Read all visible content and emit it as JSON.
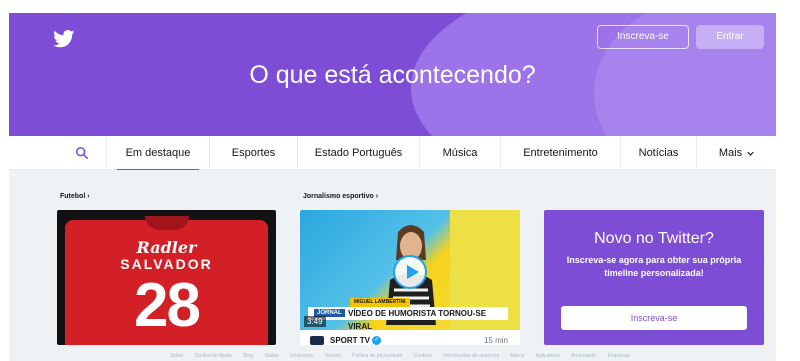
{
  "header": {
    "title": "O que está acontecendo?",
    "signup_label": "Inscreva-se",
    "login_label": "Entrar",
    "logo_icon": "twitter-bird-icon",
    "accent_color": "#7e4dd6"
  },
  "nav": {
    "search_icon": "search-icon",
    "tabs": [
      {
        "label": "Em destaque",
        "active": true
      },
      {
        "label": "Esportes",
        "active": false
      },
      {
        "label": "Estado Português",
        "active": false
      },
      {
        "label": "Música",
        "active": false
      },
      {
        "label": "Entretenimento",
        "active": false
      },
      {
        "label": "Notícias",
        "active": false
      },
      {
        "label": "Mais",
        "active": false
      }
    ]
  },
  "cards": {
    "first": {
      "category": "Futebol ›",
      "shirt_sponsor": "Radler",
      "shirt_name": "SALVADOR",
      "shirt_number": "28"
    },
    "second": {
      "category": "Jornalismo esportivo ›",
      "video_tag": "MIGUEL LAMBERTINI",
      "video_channel": "JORNAL",
      "video_caption": "VÍDEO DE HUMORISTA TORNOU-SE VIRAL",
      "duration": "3:49",
      "source": "SPORT TV",
      "time": "15 min"
    }
  },
  "promo": {
    "title": "Novo no Twitter?",
    "text": "Inscreva-se agora para obter sua própria timeline personalizada!",
    "button": "Inscreva-se"
  },
  "footer": {
    "links": [
      "Sobre",
      "Central de Ajuda",
      "Blog",
      "Status",
      "Empregos",
      "Termos",
      "Política de privacidade",
      "Cookies",
      "Informações de anúncios",
      "Marca",
      "Aplicativos",
      "Anunciante",
      "Empresas"
    ]
  }
}
